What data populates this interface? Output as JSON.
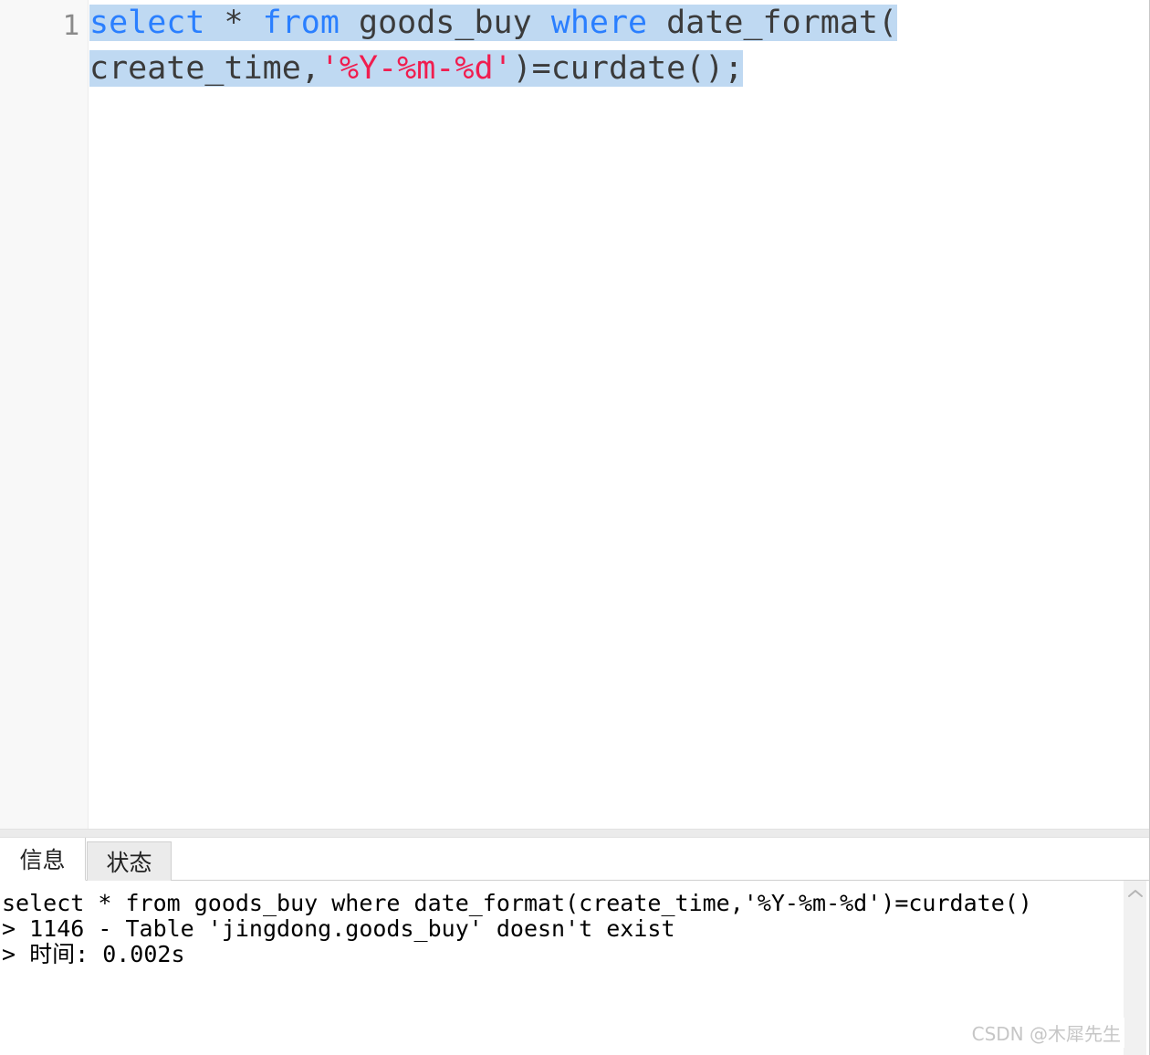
{
  "editor": {
    "line_number": "1",
    "lines": [
      {
        "tokens": [
          {
            "text": "select",
            "type": "keyword"
          },
          {
            "text": " * ",
            "type": "operator"
          },
          {
            "text": "from",
            "type": "keyword"
          },
          {
            "text": " goods_buy ",
            "type": "identifier"
          },
          {
            "text": "where",
            "type": "keyword"
          },
          {
            "text": " date_format(",
            "type": "identifier"
          }
        ]
      },
      {
        "tokens": [
          {
            "text": "create_time,",
            "type": "identifier"
          },
          {
            "text": "'%Y-%m-%d'",
            "type": "string"
          },
          {
            "text": ")=curdate();",
            "type": "identifier"
          }
        ]
      }
    ],
    "full_text": "select * from goods_buy where date_format(create_time,'%Y-%m-%d')=curdate();",
    "selected": true
  },
  "bottom_panel": {
    "tabs": [
      {
        "label": "信息",
        "active": true
      },
      {
        "label": "状态",
        "active": false
      }
    ],
    "messages": [
      "select * from goods_buy where date_format(create_time,'%Y-%m-%d')=curdate()",
      "> 1146 - Table 'jingdong.goods_buy' doesn't exist",
      "> 时间: 0.002s"
    ],
    "scrollbar": {
      "up_arrow_icon": "chevron-up-icon"
    }
  },
  "watermark": {
    "text": "CSDN @木犀先生"
  },
  "colors": {
    "keyword": "#2a7fff",
    "string": "#f01d4f",
    "identifier": "#3b3b3b",
    "selection": "#bfd9f2",
    "gutter_bg": "#f8f8f8",
    "tab_inactive_bg": "#ebebeb",
    "watermark": "#c6c6c6"
  }
}
